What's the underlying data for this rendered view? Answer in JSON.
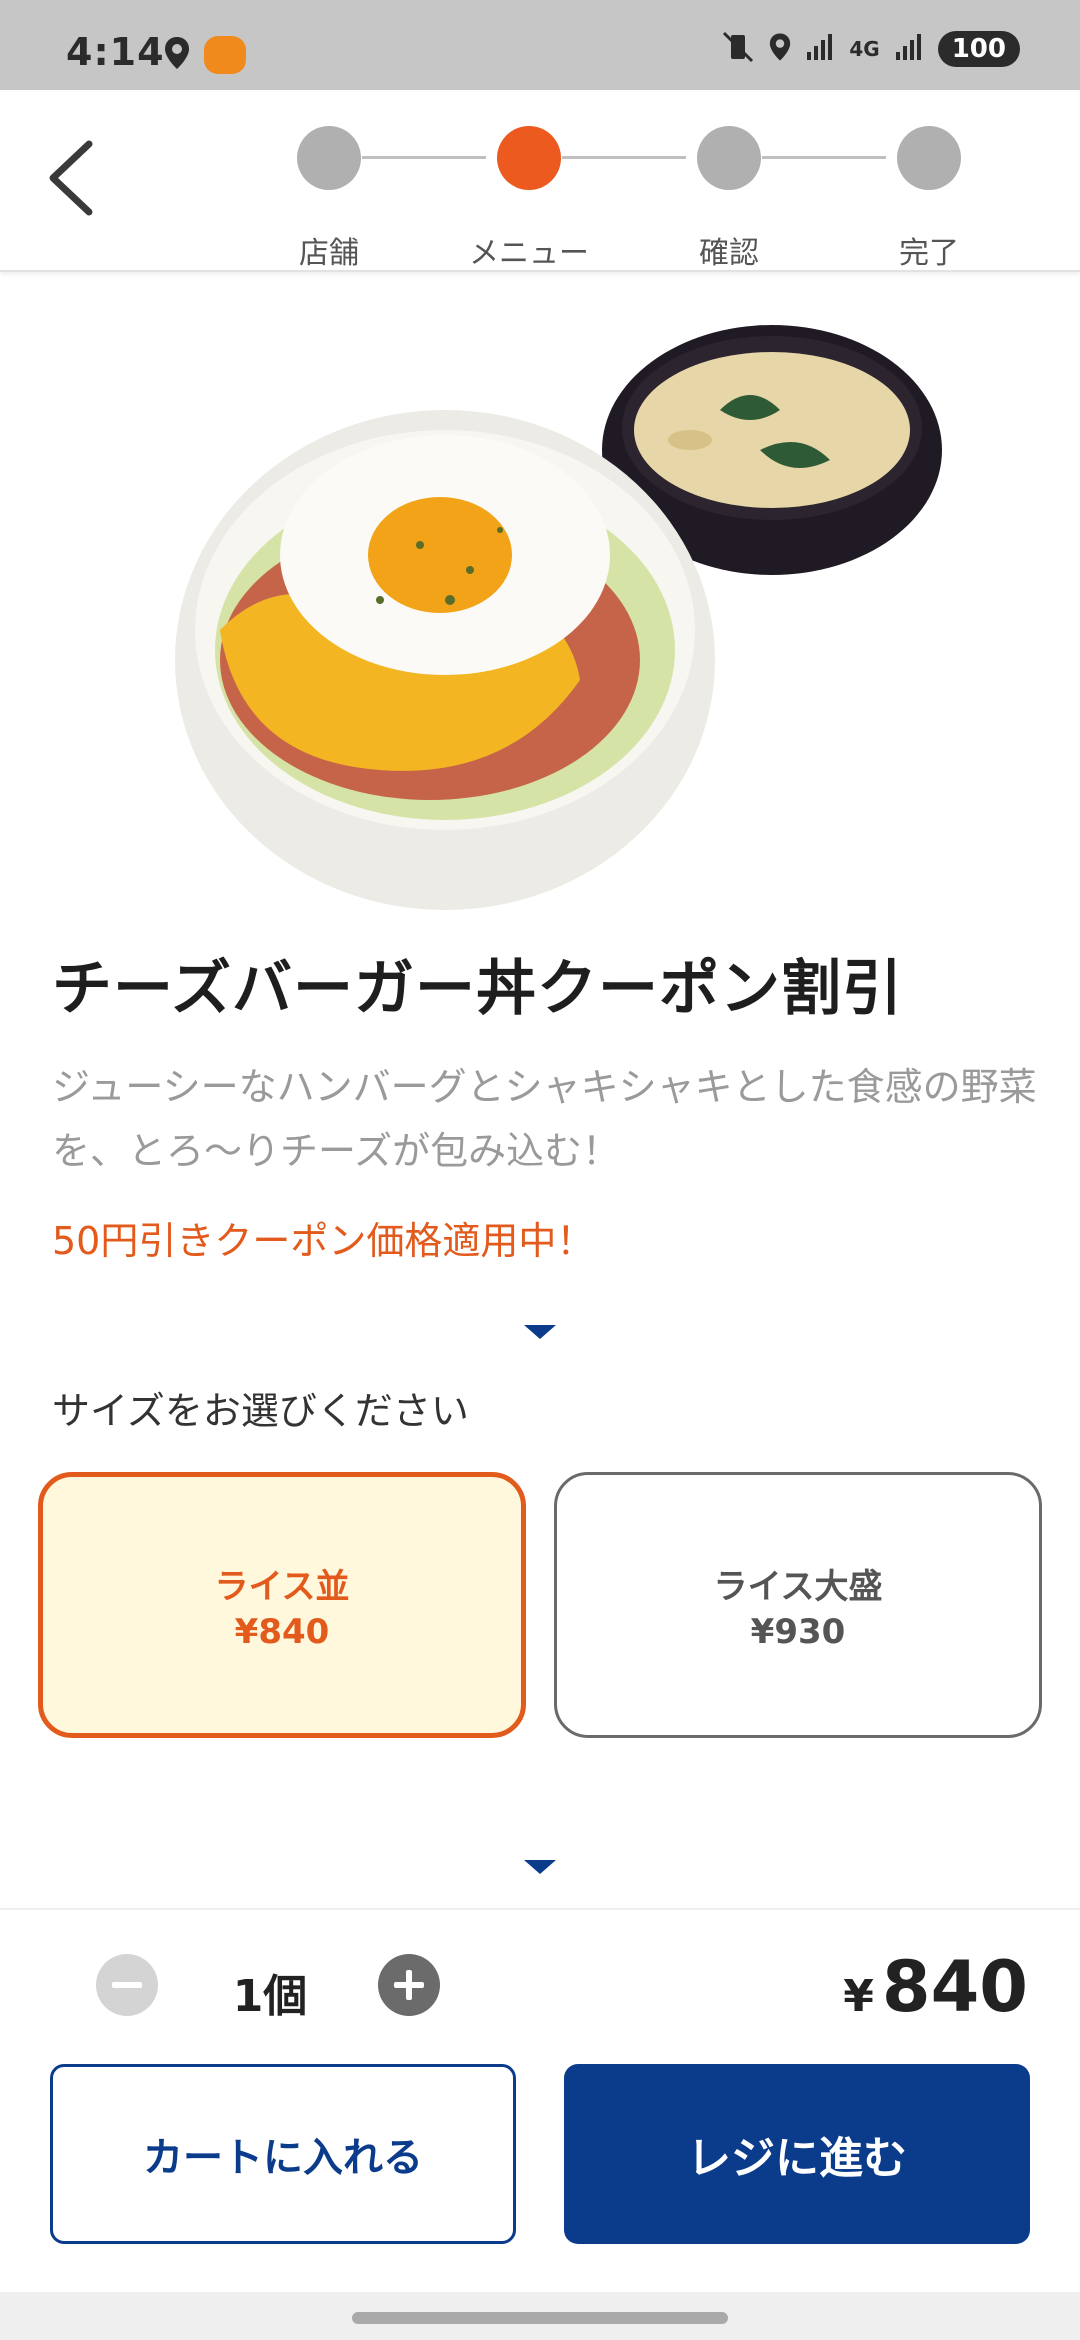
{
  "status_bar": {
    "time": "4:14",
    "network": "4G",
    "battery": "100",
    "icons": [
      "location-icon",
      "app-notification-icon",
      "vibrate-off-icon",
      "location-icon",
      "signal-icon",
      "signal-icon"
    ]
  },
  "header": {
    "back_icon": "chevron-left-icon",
    "steps": [
      {
        "label": "店舗",
        "active": false
      },
      {
        "label": "メニュー",
        "active": true
      },
      {
        "label": "確認",
        "active": false
      },
      {
        "label": "完了",
        "active": false
      }
    ]
  },
  "product": {
    "title": "チーズバーガー丼クーポン割引",
    "description": "ジューシーなハンバーグとシャキシャキとした食感の野菜を、とろ〜りチーズが包み込む！",
    "coupon_note": "50円引きクーポン価格適用中！"
  },
  "size_section": {
    "title": "サイズをお選びください",
    "options": [
      {
        "name": "ライス並",
        "price": "¥840",
        "selected": true
      },
      {
        "name": "ライス大盛",
        "price": "¥930",
        "selected": false
      }
    ]
  },
  "order": {
    "quantity": "1個",
    "total_currency": "¥",
    "total_amount": "840",
    "cart_label": "カートに入れる",
    "checkout_label": "レジに進む"
  },
  "colors": {
    "accent": "#ec5a1f",
    "primary": "#0b3c8c",
    "selected_bg": "#fff8dc"
  }
}
